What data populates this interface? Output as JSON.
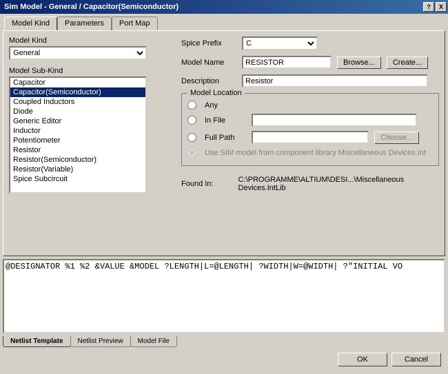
{
  "title": "Sim Model - General / Capacitor(Semiconductor)",
  "topTabs": {
    "t0": "Model Kind",
    "t1": "Parameters",
    "t2": "Port Map"
  },
  "modelKind": {
    "label": "Model Kind",
    "value": "General"
  },
  "subKind": {
    "label": "Model Sub-Kind",
    "items": {
      "i0": "Capacitor",
      "i1": "Capacitor(Semiconductor)",
      "i2": "Coupled Inductors",
      "i3": "Diode",
      "i4": "Generic Editor",
      "i5": "Inductor",
      "i6": "Potentiometer",
      "i7": "Resistor",
      "i8": "Resistor(Semiconductor)",
      "i9": "Resistor(Variable)",
      "i10": "Spice Subcircuit"
    }
  },
  "form": {
    "spicePrefixLabel": "Spice Prefix",
    "spicePrefixValue": "C",
    "modelNameLabel": "Model Name",
    "modelNameValue": "RESISTOR",
    "browseBtn": "Browse...",
    "createBtn": "Create...",
    "descriptionLabel": "Description",
    "descriptionValue": "Resistor"
  },
  "location": {
    "groupTitle": "Model Location",
    "anyLabel": "Any",
    "inFileLabel": "In File",
    "fullPathLabel": "Full Path",
    "chooseBtn": "Choose...",
    "useLibLabel": "Use SIM model from component library Miscellaneous Devices.Int"
  },
  "foundIn": {
    "label": "Found In:",
    "value": "C:\\PROGRAMME\\ALTIUM\\DESI...\\Miscellaneous Devices.IntLib"
  },
  "netlist": {
    "content": "@DESIGNATOR %1 %2 &VALUE &MODEL ?LENGTH|L=@LENGTH| ?WIDTH|W=@WIDTH| ?\"INITIAL VO"
  },
  "bottomTabs": {
    "t0": "Netlist Template",
    "t1": "Netlist Preview",
    "t2": "Model File"
  },
  "buttons": {
    "ok": "OK",
    "cancel": "Cancel"
  },
  "titlebarBtns": {
    "help": "?",
    "close": "X"
  }
}
